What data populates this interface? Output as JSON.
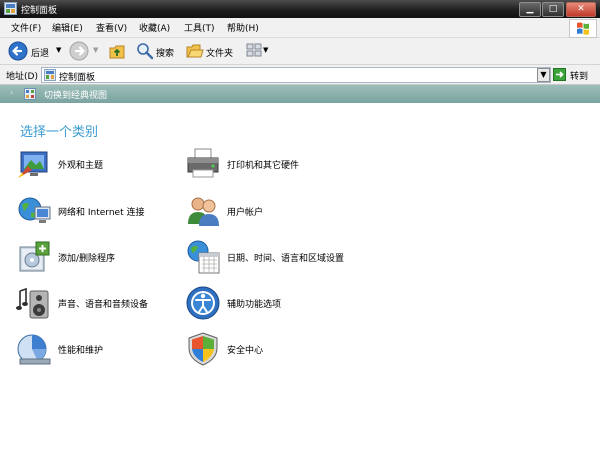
{
  "window": {
    "title": "控制面板"
  },
  "menu": [
    "文件(F)",
    "编辑(E)",
    "查看(V)",
    "收藏(A)",
    "工具(T)",
    "帮助(H)"
  ],
  "toolbar": {
    "back": "后退",
    "search": "搜索",
    "folders": "文件夹"
  },
  "address": {
    "label": "地址(D)",
    "value": "控制面板",
    "go": "转到"
  },
  "task": {
    "switch_view": "切换到经典视图"
  },
  "heading": "选择一个类别",
  "categories": [
    {
      "label": "外观和主题",
      "icon": "appearance-themes-icon"
    },
    {
      "label": "打印机和其它硬件",
      "icon": "printer-hardware-icon"
    },
    {
      "label": "网络和 Internet 连接",
      "icon": "network-internet-icon"
    },
    {
      "label": "用户帐户",
      "icon": "user-accounts-icon"
    },
    {
      "label": "添加/删除程序",
      "icon": "add-remove-programs-icon"
    },
    {
      "label": "日期、时间、语言和区域设置",
      "icon": "date-time-region-icon"
    },
    {
      "label": "声音、语音和音频设备",
      "icon": "sounds-audio-icon"
    },
    {
      "label": "辅助功能选项",
      "icon": "accessibility-icon"
    },
    {
      "label": "性能和维护",
      "icon": "performance-maintenance-icon"
    },
    {
      "label": "安全中心",
      "icon": "security-center-icon"
    }
  ],
  "colors": {
    "accent": "#3a9bd0",
    "task_band": "#87aeaa",
    "title_bar": "#2b2b2b"
  }
}
